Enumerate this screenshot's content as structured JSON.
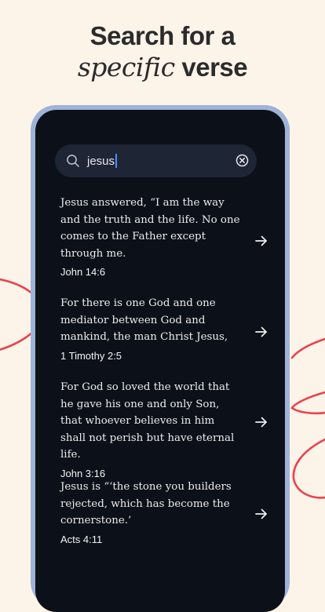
{
  "headline": {
    "line1": "Search for a",
    "line2_italic": "specific",
    "line2_rest": " verse"
  },
  "search": {
    "query": "jesus",
    "search_icon": "search-icon",
    "clear_icon": "clear-circle-x-icon"
  },
  "results": [
    {
      "verse": "Jesus answered, “I am the way and the truth and the life. No one comes to the Father except through me.",
      "reference": "John 14:6",
      "arrow_icon": "arrow-right-icon"
    },
    {
      "verse": "For there is one God and one mediator between God and mankind, the man Christ Jesus,",
      "reference": "1 Timothy 2:5",
      "arrow_icon": "arrow-right-icon"
    },
    {
      "verse": "For God so loved the world that he gave his one and only Son, that whoever believes in him shall not perish but have eternal life.",
      "reference": "John 3:16",
      "arrow_icon": "arrow-right-icon"
    },
    {
      "verse": "Jesus is “‘the stone you builders rejected, which has become the cornerstone.’",
      "reference": "Acts 4:11",
      "arrow_icon": "arrow-right-icon"
    }
  ],
  "colors": {
    "background": "#fcf3e9",
    "phone_frame": "#9fb2d8",
    "screen": "#0c1018",
    "search_field": "#1e2535",
    "caret": "#4f8cff",
    "scribble": "#e8434f"
  }
}
